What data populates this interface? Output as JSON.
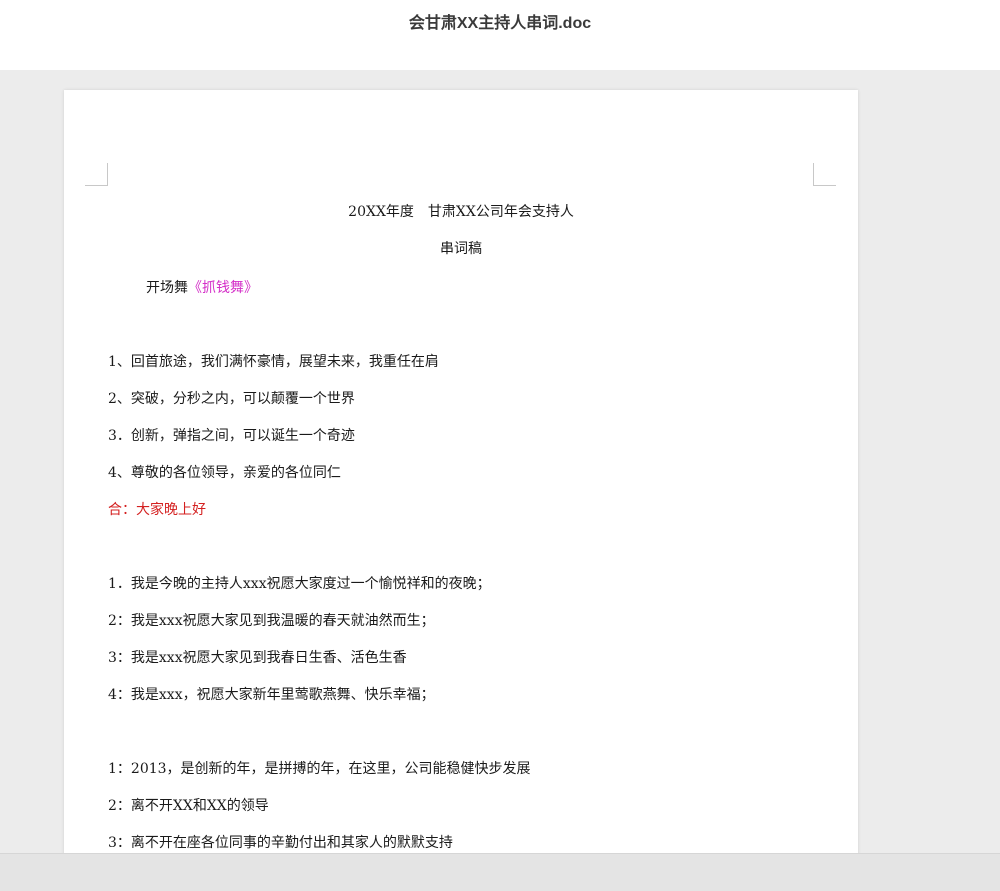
{
  "window": {
    "title": "会甘肃XX主持人串词.doc"
  },
  "document": {
    "heading_line1": "20XX年度　甘肃XX公司年会支持人",
    "heading_line2": "串词稿",
    "opening_prefix": "开场舞",
    "opening_title": "《抓钱舞》",
    "section1": [
      "1、回首旅途，我们满怀豪情，展望未来，我重任在肩",
      "2、突破，分秒之内，可以颠覆一个世界",
      "3．创新，弹指之间，可以诞生一个奇迹",
      "4、尊敬的各位领导，亲爱的各位同仁"
    ],
    "section1_together": "合：大家晚上好",
    "section2": [
      "1．我是今晚的主持人xxx祝愿大家度过一个愉悦祥和的夜晚；",
      "2：我是xxx祝愿大家见到我温暖的春天就油然而生；",
      "3：我是xxx祝愿大家见到我春日生香、活色生香",
      "4：我是xxx，祝愿大家新年里莺歌燕舞、快乐幸福；"
    ],
    "section3": [
      "1：2013，是创新的年，是拼搏的年，在这里，公司能稳健快步发展",
      "2：离不开XX和XX的领导",
      "3：离不开在座各位同事的辛勤付出和其家人的默默支持"
    ]
  }
}
